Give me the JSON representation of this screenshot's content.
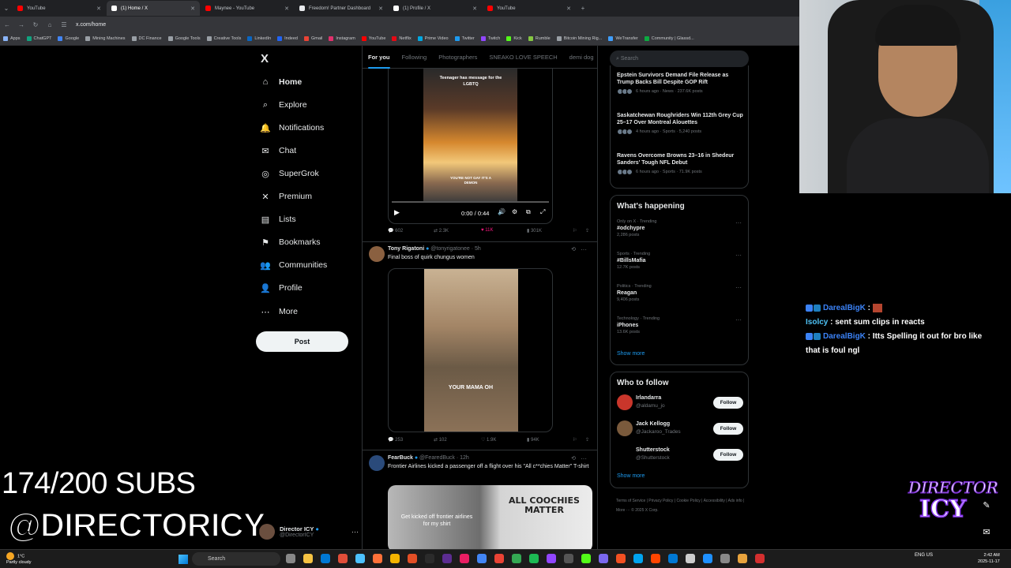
{
  "browser": {
    "tabs": [
      {
        "label": "YouTube",
        "color": "#ff0000"
      },
      {
        "label": "(1) Home / X",
        "color": "#ffffff",
        "active": true
      },
      {
        "label": "Maynee - YouTube",
        "color": "#ff0000"
      },
      {
        "label": "Freedom! Partner Dashboard",
        "color": "#e8eaed"
      },
      {
        "label": "(1) Profile / X",
        "color": "#ffffff"
      },
      {
        "label": "YouTube",
        "color": "#ff0000"
      }
    ],
    "url": "x.com/home",
    "bookmarks": [
      {
        "label": "Apps",
        "color": "#8ab4f8"
      },
      {
        "label": "ChatGPT",
        "color": "#10a37f"
      },
      {
        "label": "Google",
        "color": "#4285f4"
      },
      {
        "label": "Mining Machines",
        "color": "#9aa0a6"
      },
      {
        "label": "DC Finance",
        "color": "#9aa0a6"
      },
      {
        "label": "Google Tools",
        "color": "#9aa0a6"
      },
      {
        "label": "Creative Tools",
        "color": "#9aa0a6"
      },
      {
        "label": "LinkedIn",
        "color": "#0a66c2"
      },
      {
        "label": "Indeed",
        "color": "#2164f3"
      },
      {
        "label": "Gmail",
        "color": "#ea4335"
      },
      {
        "label": "Instagram",
        "color": "#e1306c"
      },
      {
        "label": "YouTube",
        "color": "#ff0000"
      },
      {
        "label": "Netflix",
        "color": "#e50914"
      },
      {
        "label": "Prime Video",
        "color": "#00a8e1"
      },
      {
        "label": "Twitter",
        "color": "#1d9bf0"
      },
      {
        "label": "Twitch",
        "color": "#9146ff"
      },
      {
        "label": "Kick",
        "color": "#53fc18"
      },
      {
        "label": "Rumble",
        "color": "#85c742"
      },
      {
        "label": "Bitcoin Mining Rig...",
        "color": "#9aa0a6"
      },
      {
        "label": "WeTransfer",
        "color": "#409fff"
      },
      {
        "label": "Community | Glassd...",
        "color": "#0caa41"
      }
    ]
  },
  "sidebar": {
    "logo": "X",
    "items": [
      {
        "label": "Home",
        "icon": "home-icon",
        "glyph": "⌂"
      },
      {
        "label": "Explore",
        "icon": "search-icon",
        "glyph": "⌕"
      },
      {
        "label": "Notifications",
        "icon": "bell-icon",
        "glyph": "🔔"
      },
      {
        "label": "Chat",
        "icon": "mail-icon",
        "glyph": "✉"
      },
      {
        "label": "SuperGrok",
        "icon": "grok-icon",
        "glyph": "◎"
      },
      {
        "label": "Premium",
        "icon": "x-icon",
        "glyph": "✕"
      },
      {
        "label": "Lists",
        "icon": "list-icon",
        "glyph": "▤"
      },
      {
        "label": "Bookmarks",
        "icon": "bookmark-icon",
        "glyph": "⚑"
      },
      {
        "label": "Communities",
        "icon": "communities-icon",
        "glyph": "👥"
      },
      {
        "label": "Profile",
        "icon": "profile-icon",
        "glyph": "👤"
      },
      {
        "label": "More",
        "icon": "more-icon",
        "glyph": "⋯"
      }
    ],
    "post_label": "Post",
    "account": {
      "name": "Director ICY",
      "handle": "@DirectorICY"
    }
  },
  "feed": {
    "tabs": [
      "For you",
      "Following",
      "Photographers",
      "SNEAKO LOVE SPEECH",
      "demi dog"
    ],
    "video1": {
      "caption_top": "Teenager has message for the LGBTQ",
      "caption_bottom": "YOU'RE NOT GAY IT'S A DEMON",
      "time": "0:00 / 0:44",
      "actions": {
        "replies": "602",
        "reposts": "2.3K",
        "likes": "11K",
        "views": "301K"
      }
    },
    "tweet2": {
      "name": "Tony Rigatoni",
      "handle": "@tonyrigatonee · 5h",
      "text": "Final boss of quirk chungus women",
      "video_caption": "YOUR MAMA OH",
      "actions": {
        "replies": "253",
        "reposts": "102",
        "likes": "1.9K",
        "views": "94K"
      }
    },
    "tweet3": {
      "name": "FearBuck",
      "handle": "@FearedBuck · 12h",
      "text": "Frontier Airlines kicked a passenger off a flight over his \"All c**chies Matter\" T-shirt",
      "img_caption": "Get kicked off frontier airlines for my shirt",
      "shirt_text": "ALL COOCHIES MATTER"
    }
  },
  "right": {
    "search_placeholder": "Search",
    "news": [
      {
        "title": "Epstein Survivors Demand File Release as Trump Backs Bill Despite GOP Rift",
        "meta": "6 hours ago · News · 237.6K posts"
      },
      {
        "title": "Saskatchewan Roughriders Win 112th Grey Cup 25–17 Over Montreal Alouettes",
        "meta": "4 hours ago · Sports · 5,240 posts"
      },
      {
        "title": "Ravens Overcome Browns 23–16 in Shedeur Sanders' Tough NFL Debut",
        "meta": "6 hours ago · Sports · 71.9K posts"
      }
    ],
    "happening_title": "What's happening",
    "trends": [
      {
        "context": "Only on X · Trending",
        "name": "#odchypre",
        "posts": "2,286 posts"
      },
      {
        "context": "Sports · Trending",
        "name": "#BillsMafia",
        "posts": "12.7K posts"
      },
      {
        "context": "Politics · Trending",
        "name": "Reagan",
        "posts": "9,406 posts"
      },
      {
        "context": "Technology · Trending",
        "name": "iPhones",
        "posts": "13.6K posts"
      }
    ],
    "show_more": "Show more",
    "wtf_title": "Who to follow",
    "follow": [
      {
        "name": "Irlandarra",
        "handle": "@aldamu_jo",
        "avatar_color": "#c9362b"
      },
      {
        "name": "Jack Kellogg",
        "handle": "@Jackaroo_Trades",
        "avatar_color": "#7a5a3c"
      },
      {
        "name": "Shutterstock",
        "handle": "@Shutterstock",
        "avatar_color": "#000000"
      }
    ],
    "follow_label": "Follow",
    "footer": "Terms of Service | Privacy Policy | Cookie Policy | Accessibility | Ads info | More ··· © 2025 X Corp."
  },
  "overlay": {
    "subs": "174/200 SUBS",
    "handle": "@DIRECTORICY",
    "logo_top": "DIRECTOR",
    "logo_bottom": "ICY",
    "chat": [
      {
        "user": "DarealBigK",
        "message": ""
      },
      {
        "user": "Isolcy",
        "message": "sent sum clips in reacts"
      },
      {
        "user": "DarealBigK",
        "message": "Itts Spelling it out for bro like that is foul ngl"
      }
    ]
  },
  "taskbar": {
    "weather_temp": "1°C",
    "weather_desc": "Partly cloudy",
    "search_label": "Search",
    "lang": "ENG US",
    "time": "2:42 AM",
    "date": "2025-11-17"
  }
}
